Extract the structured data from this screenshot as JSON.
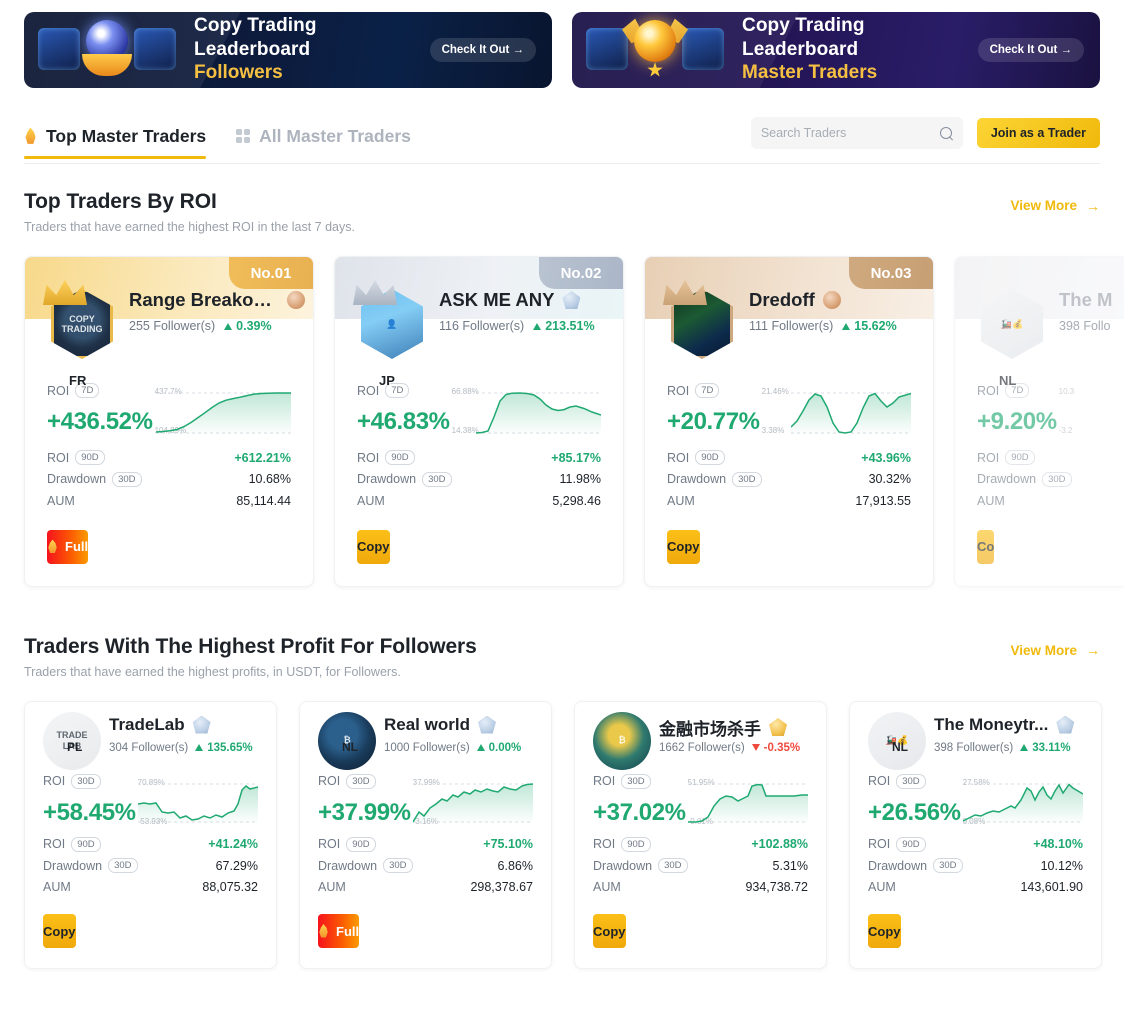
{
  "banners": [
    {
      "title": "Copy Trading Leaderboard",
      "subtitle": "Followers",
      "cta": "Check It Out →",
      "theme": "blue"
    },
    {
      "title": "Copy Trading Leaderboard",
      "subtitle": "Master Traders",
      "cta": "Check It Out →",
      "theme": "purple"
    }
  ],
  "tabs": [
    {
      "label": "Top Master Traders",
      "icon": "flame-icon",
      "active": true
    },
    {
      "label": "All Master Traders",
      "icon": "grid-icon",
      "active": false
    }
  ],
  "search": {
    "placeholder": "Search Traders",
    "value": "",
    "icon": "search-icon"
  },
  "join_button": {
    "label": "Join as a Trader"
  },
  "sections": [
    {
      "id": "top-traders-by-roi",
      "title": "Top Traders By ROI",
      "subtitle": "Traders that have earned the highest ROI in the last 7 days.",
      "view_more": "View More"
    },
    {
      "id": "highest-profit-for-followers",
      "title": "Traders With The Highest Profit For Followers",
      "subtitle": "Traders that have earned the highest profits, in USDT, for Followers.",
      "view_more": "View More"
    }
  ],
  "labels": {
    "roi": "ROI",
    "drawdown": "Drawdown",
    "aum": "AUM",
    "pill_7d": "7D",
    "pill_30d": "30D",
    "pill_90d": "90D",
    "copy": "Copy",
    "full": "Full"
  },
  "roi_cards": [
    {
      "rank": "No.01",
      "name": "Range Breakou...",
      "badge": "bronze-medal-icon",
      "followers": "255 Follower(s)",
      "delta": "0.39%",
      "delta_dir": "up",
      "country": "FR",
      "roi_period": "7D",
      "roi_value": "+436.52%",
      "spark_high": "437.7%",
      "spark_low": "104.89%",
      "roi90": "+612.21%",
      "drawdown": "10.68%",
      "aum": "85,114.44",
      "cta": "Full",
      "cta_type": "full",
      "avatar": "copytrading-shield-avatar"
    },
    {
      "rank": "No.02",
      "name": "ASK ME ANY",
      "badge": "diamond-medal-icon",
      "followers": "116 Follower(s)",
      "delta": "213.51%",
      "delta_dir": "up",
      "country": "JP",
      "roi_period": "7D",
      "roi_value": "+46.83%",
      "spark_high": "66.88%",
      "spark_low": "14.38%",
      "roi90": "+85.17%",
      "drawdown": "11.98%",
      "aum": "5,298.46",
      "cta": "Copy",
      "cta_type": "copy",
      "avatar": "person-photo-avatar"
    },
    {
      "rank": "No.03",
      "name": "Dredoff",
      "badge": "bronze-medal-icon",
      "followers": "111 Follower(s)",
      "delta": "15.62%",
      "delta_dir": "up",
      "country": "",
      "roi_period": "7D",
      "roi_value": "+20.77%",
      "spark_high": "21.46%",
      "spark_low": "3.38%",
      "roi90": "+43.96%",
      "drawdown": "30.32%",
      "aum": "17,913.55",
      "cta": "Copy",
      "cta_type": "copy",
      "avatar": "trading-chart-avatar"
    },
    {
      "rank": "",
      "name": "The M",
      "badge": "",
      "followers": "398 Follo",
      "delta": "",
      "delta_dir": "up",
      "country": "NL",
      "roi_period": "7D",
      "roi_value": "+9.20%",
      "spark_high": "10.3",
      "spark_low": "-3.2",
      "roi90": "",
      "drawdown": "",
      "aum": "",
      "cta": "Co",
      "cta_type": "copy",
      "avatar": "train-money-avatar"
    }
  ],
  "profit_cards": [
    {
      "name": "TradeLab",
      "badge": "diamond-medal-icon",
      "followers": "304 Follower(s)",
      "delta": "135.65%",
      "delta_dir": "up",
      "country": "PL",
      "roi_period": "30D",
      "roi_value": "+58.45%",
      "spark_high": "70.89%",
      "spark_low": "-53.93%",
      "roi90": "+41.24%",
      "drawdown": "67.29%",
      "aum": "88,075.32",
      "cta": "Copy",
      "cta_type": "copy",
      "avatar": "tradelab-logo-avatar"
    },
    {
      "name": "Real world",
      "badge": "diamond-medal-icon",
      "followers": "1000 Follower(s)",
      "delta": "0.00%",
      "delta_dir": "up",
      "country": "NL",
      "roi_period": "30D",
      "roi_value": "+37.99%",
      "spark_high": "37.99%",
      "spark_low": "-3.16%",
      "roi90": "+75.10%",
      "drawdown": "6.86%",
      "aum": "298,378.67",
      "cta": "Full",
      "cta_type": "full",
      "avatar": "earth-bitcoin-avatar"
    },
    {
      "name": "金融市场杀手",
      "badge": "gold-medal-icon",
      "followers": "1662 Follower(s)",
      "delta": "-0.35%",
      "delta_dir": "down",
      "country": "",
      "roi_period": "30D",
      "roi_value": "+37.02%",
      "spark_high": "51.95%",
      "spark_low": "-0.01%",
      "roi90": "+102.88%",
      "drawdown": "5.31%",
      "aum": "934,738.72",
      "cta": "Copy",
      "cta_type": "copy",
      "avatar": "bitcoin-globe-avatar"
    },
    {
      "name": "The Moneytr...",
      "badge": "diamond-medal-icon",
      "followers": "398 Follower(s)",
      "delta": "33.11%",
      "delta_dir": "up",
      "country": "NL",
      "roi_period": "30D",
      "roi_value": "+26.56%",
      "spark_high": "27.58%",
      "spark_low": "0.08%",
      "roi90": "+48.10%",
      "drawdown": "10.12%",
      "aum": "143,601.90",
      "cta": "Copy",
      "cta_type": "copy",
      "avatar": "train-money-avatar"
    }
  ],
  "colors": {
    "accent": "#f0b90b",
    "green": "#1fa971",
    "red": "#f0493e",
    "text": "#1e2329",
    "muted": "#707a86"
  },
  "chart_data": [
    {
      "type": "area",
      "title": "Range Breakou... ROI 7D",
      "ylim": [
        104.89,
        437.7
      ],
      "y": [
        105,
        108,
        112,
        120,
        138,
        165,
        200,
        240,
        285,
        325,
        352,
        368,
        382,
        398,
        418,
        430,
        436,
        437,
        437
      ]
    },
    {
      "type": "area",
      "title": "ASK ME ANY ROI 7D",
      "ylim": [
        14.38,
        66.88
      ],
      "y": [
        14.4,
        14.5,
        15,
        30,
        52,
        64,
        66.5,
        66.8,
        66.5,
        65.8,
        63,
        56,
        50,
        48,
        49,
        52,
        53,
        50,
        45,
        41
      ]
    },
    {
      "type": "area",
      "title": "Dredoff ROI 7D",
      "ylim": [
        3.38,
        21.46
      ],
      "y": [
        5,
        8,
        13,
        19,
        21.4,
        20.5,
        15,
        7,
        3.6,
        3.4,
        3.5,
        6,
        13,
        20,
        21.4,
        18,
        15.5,
        17,
        19.5,
        21.4
      ]
    },
    {
      "type": "area",
      "title": "The M ROI 7D",
      "ylim": [
        -3.2,
        10.3
      ],
      "y": [
        0,
        1,
        2,
        1.5,
        3,
        4,
        6,
        7,
        8,
        9,
        9.2
      ]
    },
    {
      "type": "area",
      "title": "TradeLab ROI 30D",
      "ylim": [
        -53.93,
        70.89
      ],
      "y": [
        -20,
        -18,
        -19,
        -18,
        -30,
        -32,
        -31,
        -40,
        -38,
        -44,
        -42,
        -38,
        -40,
        -36,
        -38,
        -34,
        -30,
        -20,
        20,
        52,
        60,
        55,
        58
      ]
    },
    {
      "type": "area",
      "title": "Real world ROI 30D",
      "ylim": [
        -3.16,
        37.99
      ],
      "y": [
        -3,
        2,
        0,
        6,
        9,
        14,
        12,
        18,
        16,
        21,
        19,
        24,
        22,
        26,
        24,
        23,
        28,
        26,
        25,
        30,
        33,
        31,
        38
      ]
    },
    {
      "type": "area",
      "title": "金融市场杀手 ROI 30D",
      "ylim": [
        -0.01,
        51.95
      ],
      "y": [
        0,
        0,
        1,
        3,
        14,
        24,
        28,
        27,
        22,
        26,
        28,
        50,
        51.9,
        36,
        36,
        36,
        36,
        36,
        37,
        37
      ]
    },
    {
      "type": "area",
      "title": "The Moneytr... ROI 30D",
      "ylim": [
        0.08,
        27.58
      ],
      "y": [
        0.1,
        1,
        3,
        2.5,
        4,
        6,
        5.5,
        7,
        9,
        8,
        12,
        20,
        18,
        13,
        19,
        23,
        17,
        14,
        21,
        26,
        20,
        27.5,
        22
      ]
    }
  ]
}
